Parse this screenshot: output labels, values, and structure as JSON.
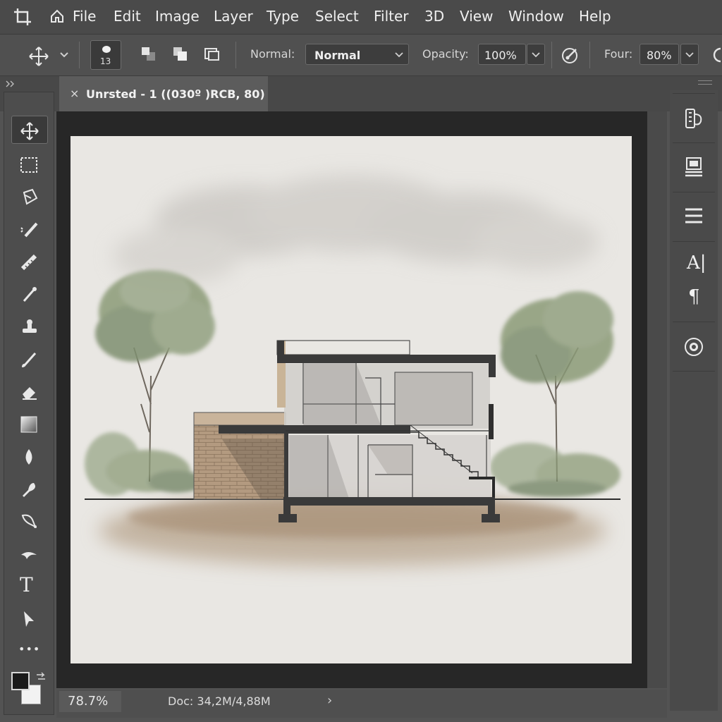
{
  "menubar": {
    "items": [
      "File",
      "Edit",
      "Image",
      "Layer",
      "Type",
      "Select",
      "Filter",
      "3D",
      "View",
      "Window",
      "Help"
    ]
  },
  "options": {
    "brush_size": "13",
    "mode_label": "Normal:",
    "mode_value": "Normal",
    "opacity_label": "Opacity:",
    "opacity_value": "100%",
    "flow_label": "Four:",
    "flow_value": "80%"
  },
  "document": {
    "tab_title": "Unrsted - 1 ((030º )RCB, 80)",
    "close_glyph": "×"
  },
  "toolbar": {
    "tools": [
      "move-tool",
      "marquee-tool",
      "lasso-tool",
      "quick-selection-tool",
      "crop-tool",
      "healing-brush-tool",
      "clone-stamp-tool",
      "brush-tool",
      "eraser-tool",
      "gradient-tool",
      "blur-tool",
      "dodge-tool",
      "pen-tool",
      "smudge-tool",
      "type-tool",
      "path-selection-tool",
      "more-tools"
    ],
    "type_glyph": "T",
    "more_glyph": "•••"
  },
  "right_panel": {
    "char_glyph": "A|",
    "para_glyph": "¶"
  },
  "status": {
    "zoom": "78.7%",
    "doc_info": "Doc: 34,2M/4,88M",
    "arrow": "›"
  },
  "colors": {
    "accent": "#4a4a4a",
    "canvas_bg": "#e9e7e3",
    "foliage": "#8c9b78",
    "soil": "#a48a6c"
  }
}
